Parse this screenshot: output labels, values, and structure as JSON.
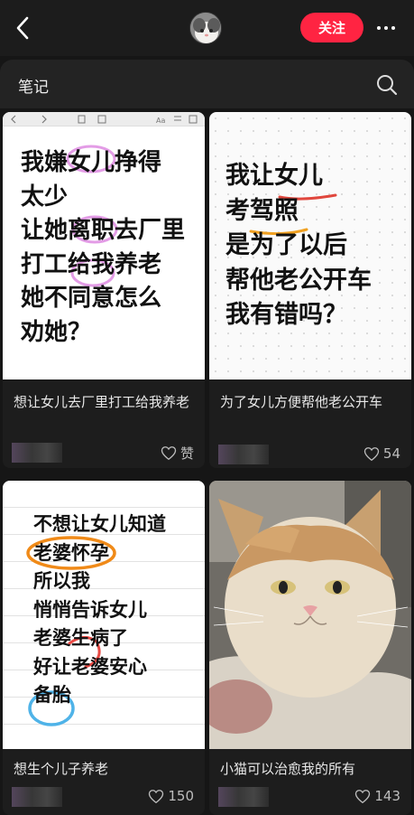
{
  "header": {
    "follow_label": "关注",
    "section_title": "笔记"
  },
  "notes": [
    {
      "title": "想让女儿去厂里打工给我养老",
      "like_label": "赞",
      "image_text": "我嫌女儿挣得\n太少\n让她离职去厂里\n打工给我养老\n她不同意怎么\n劝她？"
    },
    {
      "title": "为了女儿方便帮他老公开车",
      "like_label": "54",
      "image_text": "我让女儿\n考驾照\n是为了以后\n帮他老公开车\n我有错吗？"
    },
    {
      "title": "想生个儿子养老",
      "like_label": "150",
      "image_text": "不想让女儿知道\n老婆怀孕\n所以我\n悄悄告诉女儿\n老婆生病了\n好让老婆安心\n备胎"
    },
    {
      "title": "小猫可以治愈我的所有",
      "like_label": "143"
    }
  ],
  "icons": {
    "back": "chevron-left-icon",
    "more": "more-dots-icon",
    "search": "search-icon",
    "like": "heart-icon"
  },
  "colors": {
    "accent": "#ff2442",
    "background": "#161616"
  }
}
